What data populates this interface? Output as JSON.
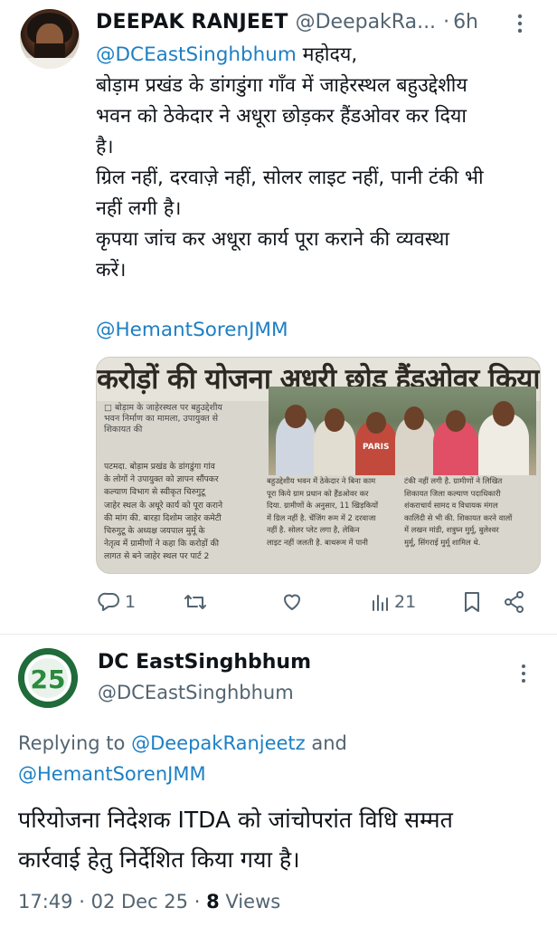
{
  "tweet": {
    "author_name": "DEEPAK RANJEET",
    "author_handle": "@DeepakRa...",
    "separator": "·",
    "time": "6h",
    "body_lines": [
      {
        "mention": "@DCEastSinghbhum",
        "text": " महोदय,"
      },
      {
        "text": "बोड़ाम प्रखंड के डांगडुंगा गाँव में जाहेरस्थल बहुउद्देशीय"
      },
      {
        "text": "भवन को ठेकेदार ने अधूरा छोड़कर हैंडओवर कर दिया"
      },
      {
        "text": "है।"
      },
      {
        "text": "ग्रिल नहीं, दरवाज़े नहीं, सोलर लाइट नहीं, पानी टंकी भी"
      },
      {
        "text": "नहीं लगी है।"
      },
      {
        "text": "कृपया जांच कर अधूरा कार्य पूरा कराने की व्यवस्था"
      },
      {
        "text": "करें।"
      }
    ],
    "mention_footer": "@HemantSorenJMM",
    "clipping": {
      "headline": "करोड़ों की योजना अधूरी छोड़ हैंडओवर किया",
      "subhead_lines": [
        "□ बोड़ाम के जाहेरस्थल पर बहुउद्देशीय",
        "भवन निर्माण का मामला, उपायुक्त से",
        "शिकायत की"
      ],
      "col1_lines": [
        "पटमदा. बोड़ाम प्रखंड के डांगडुंगा गांव",
        "के लोगों ने उपायुक्त को ज्ञापन सौंपकर",
        "कल्याण विभाग से स्वीकृत चिरुगुटू",
        "जाहेर स्थल के अधूरे कार्य को पूरा कराने",
        "की मांग की. बारहा दिशोम जाहेर कमेटी",
        "चिरुगुटू के अध्यक्ष जयपाल मुर्मू के",
        "नेतृत्व में ग्रामीणों ने कहा कि करोड़ों की",
        "लागत से बने जाहेर स्थल पर पार्ट 2"
      ],
      "caption_col2": [
        "बहुउद्देशीय भवन में ठेकेदार ने बिना काम",
        "पूरा किये ग्राम प्रधान को हैंडओवर कर",
        "दिया. ग्रामीणों के अनुसार, 11 खिड़कियों",
        "में ग्रिल नहीं है. चेंजिंग रूम में 2 दरवाजा",
        "नहीं है. सोलर प्लेट लगा है, लेकिन",
        "लाइट नहीं जलती है. बाथरूम में पानी"
      ],
      "caption_col3": [
        "टंकी नहीं लगी है. ग्रामीणों ने लिखित",
        "शिकायत जिला कल्याण पदाधिकारी",
        "शंकराचार्य सामद व विधायक मंगल",
        "कालिंदी से भी की. शिकायत करने वालों",
        "में लखन मांडी, शत्रुघ्न मुर्मू, बुलेश्वर",
        "मुर्मू, सिंगराई मुर्मू शामिल थे."
      ],
      "banner_text": "PARIS"
    },
    "actions": {
      "reply_count": "1",
      "like_count": "",
      "views_count": "21"
    }
  },
  "reply": {
    "author_name": "DC EastSinghbhum",
    "author_handle": "@DCEastSinghbhum",
    "avatar_text": "25",
    "replying_prefix": "Replying to ",
    "replying_to_1": "@DeepakRanjeetz",
    "replying_and": " and",
    "replying_to_2": "@HemantSorenJMM",
    "body_lines": [
      "परियोजना निदेशक ITDA को जांचोपरांत विधि सम्मत",
      "कार्रवाई हेतु निर्देशित किया गया है।"
    ],
    "time": "17:49",
    "date": "02 Dec 25",
    "views_count": "8",
    "views_label": "Views"
  },
  "colors": {
    "link": "#1d7fc4",
    "muted": "#536471",
    "text": "#0f1419"
  }
}
